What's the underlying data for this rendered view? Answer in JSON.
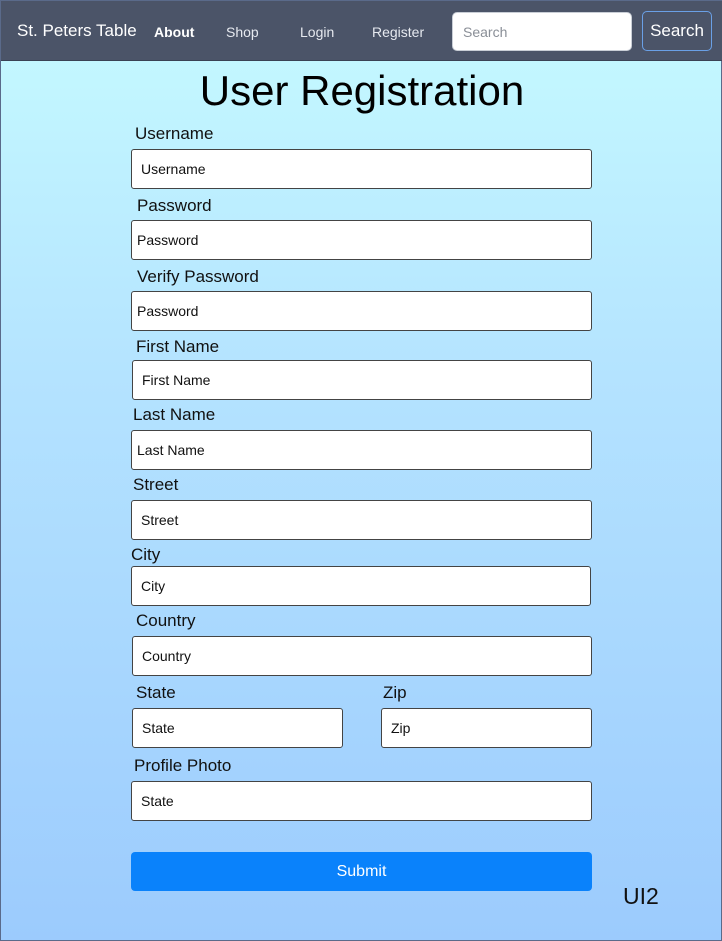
{
  "navbar": {
    "brand": "St. Peters Table",
    "links": [
      "About",
      "Shop",
      "Login",
      "Register"
    ],
    "search_placeholder": "Search",
    "search_button": "Search"
  },
  "form": {
    "title": "User Registration",
    "fields": {
      "username": {
        "label": "Username",
        "placeholder": "Username"
      },
      "password": {
        "label": "Password",
        "placeholder": "Password"
      },
      "verify_password": {
        "label": "Verify Password",
        "placeholder": "Password"
      },
      "first_name": {
        "label": "First Name",
        "placeholder": "First Name"
      },
      "last_name": {
        "label": "Last Name",
        "placeholder": "Last Name"
      },
      "street": {
        "label": "Street",
        "placeholder": "Street"
      },
      "city": {
        "label": "City",
        "placeholder": "City"
      },
      "country": {
        "label": "Country",
        "placeholder": "Country"
      },
      "state": {
        "label": "State",
        "placeholder": "State"
      },
      "zip": {
        "label": "Zip",
        "placeholder": "Zip"
      },
      "profile_photo": {
        "label": "Profile Photo",
        "placeholder": "State"
      }
    },
    "submit_label": "Submit"
  },
  "corner_tag": "UI2",
  "colors": {
    "navbar": "#4b5468",
    "submit": "#0a82fb",
    "background_top": "#c6fbff",
    "background_bottom": "#9ccbfd"
  }
}
